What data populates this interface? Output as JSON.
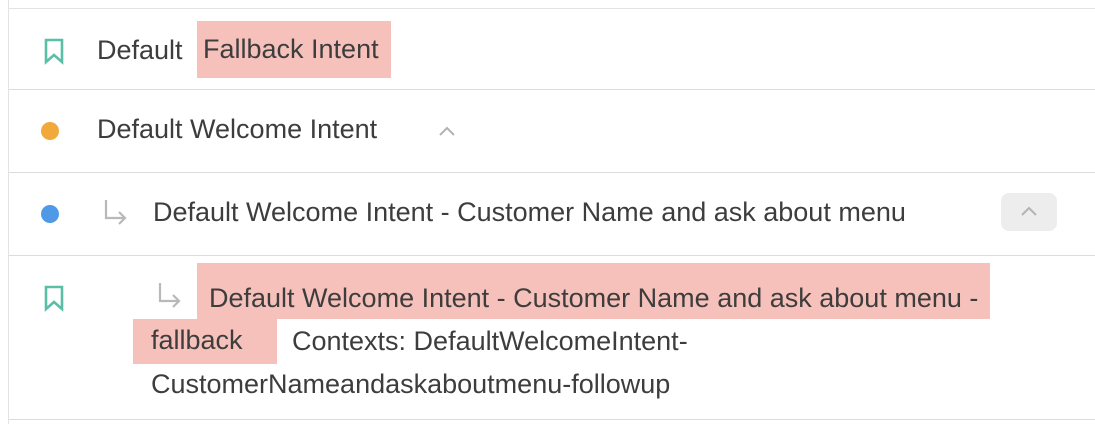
{
  "intents": [
    {
      "icon": "bookmark-icon",
      "prefix": "Default ",
      "highlight": "Fallback Intent"
    },
    {
      "icon": "dot-icon",
      "dot_color": "#f2a93b",
      "title": "Default Welcome Intent"
    },
    {
      "icon": "dot-icon",
      "dot_color": "#4e9ae6",
      "title": "Default Welcome Intent - Customer Name and ask about menu"
    },
    {
      "icon": "bookmark-icon",
      "highlight_line1": "Default Welcome Intent - Customer Name and ask about menu -",
      "highlight_line2": "fallback",
      "contexts_line1": "Contexts: DefaultWelcomeIntent-",
      "contexts_line2": "CustomerNameandaskaboutmenu-followup"
    }
  ],
  "colors": {
    "bookmark": "#5bbfa8",
    "highlight": "#f7c1bb",
    "arrow": "#b9b9b9",
    "chevron": "#b3b3b3"
  }
}
